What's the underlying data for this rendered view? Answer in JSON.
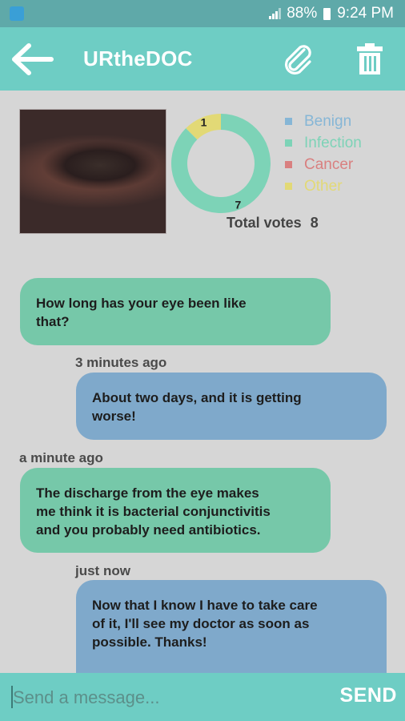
{
  "status_bar": {
    "battery": "88%",
    "time": "9:24 PM"
  },
  "app_bar": {
    "title": "URtheDOC"
  },
  "chart_data": {
    "type": "pie",
    "categories": [
      "Benign",
      "Infection",
      "Cancer",
      "Other"
    ],
    "values": [
      0,
      7,
      0,
      1
    ],
    "colors": [
      "#86b6d6",
      "#7dd3b7",
      "#d98080",
      "#e2d976"
    ],
    "data_labels": [
      "",
      "7",
      "",
      "1"
    ],
    "legend_position": "right"
  },
  "votes": {
    "label": "Total votes",
    "count": "8"
  },
  "messages": [
    {
      "side": "left",
      "lines": [
        "How long has your eye been like",
        "that?"
      ],
      "time": "3 minutes ago"
    },
    {
      "side": "right",
      "lines": [
        "About two days, and it is getting",
        "worse!"
      ],
      "time": "a minute ago"
    },
    {
      "side": "left",
      "lines": [
        "The discharge from the eye makes",
        "me think it is bacterial conjunctivitis",
        "and you probably need antibiotics."
      ],
      "time": "just now"
    },
    {
      "side": "right",
      "lines": [
        "Now that I know I have to take care",
        "of it, I'll see my doctor as soon as",
        "possible. Thanks!"
      ]
    }
  ],
  "composer": {
    "placeholder": "Send a message...",
    "send_label": "SEND"
  },
  "icons": {
    "back": "arrow-left-icon",
    "attach": "paperclip-icon",
    "delete": "trash-icon"
  }
}
